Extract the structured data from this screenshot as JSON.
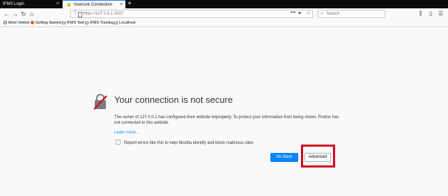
{
  "tabs": [
    {
      "label": "IFMS Login",
      "close": "×"
    },
    {
      "label": "Insecure Connection",
      "close": "×"
    }
  ],
  "new_tab": "+",
  "nav": {
    "back": "←",
    "forward": "→",
    "reload": "↻",
    "home": "⌂"
  },
  "urlbar": {
    "info": "ⓘ",
    "url": "https://127.0.0.1:2037",
    "page_actions": "•••",
    "pocket": "♥",
    "bookmark_star": "☆"
  },
  "search": {
    "placeholder": "Search",
    "icon": "⌕"
  },
  "toolbar_right": {
    "library": "⫼",
    "sidebar": "▯",
    "menu": "☰"
  },
  "bookmarks": [
    {
      "label": "Most Visited",
      "icon": "gear-icon"
    },
    {
      "label": "Getting Started",
      "icon": "firefox-icon"
    },
    {
      "label": "IFMS Test",
      "icon": "folder-icon"
    },
    {
      "label": "IFMS Training",
      "icon": "folder-icon"
    },
    {
      "label": "Localhost",
      "icon": "folder-icon"
    }
  ],
  "error_page": {
    "title": "Your connection is not secure",
    "description": "The owner of 127.0.0.1 has configured their website improperly. To protect your information from being stolen, Firefox has not connected to this website.",
    "learn_more": "Learn more…",
    "report_label": "Report errors like this to help Mozilla identify and block malicious sites",
    "go_back": "Go Back",
    "advanced": "Advanced"
  },
  "colors": {
    "accent": "#0a84ff",
    "highlight_box": "#d0021b",
    "tabbar": "#0c0c0d"
  }
}
